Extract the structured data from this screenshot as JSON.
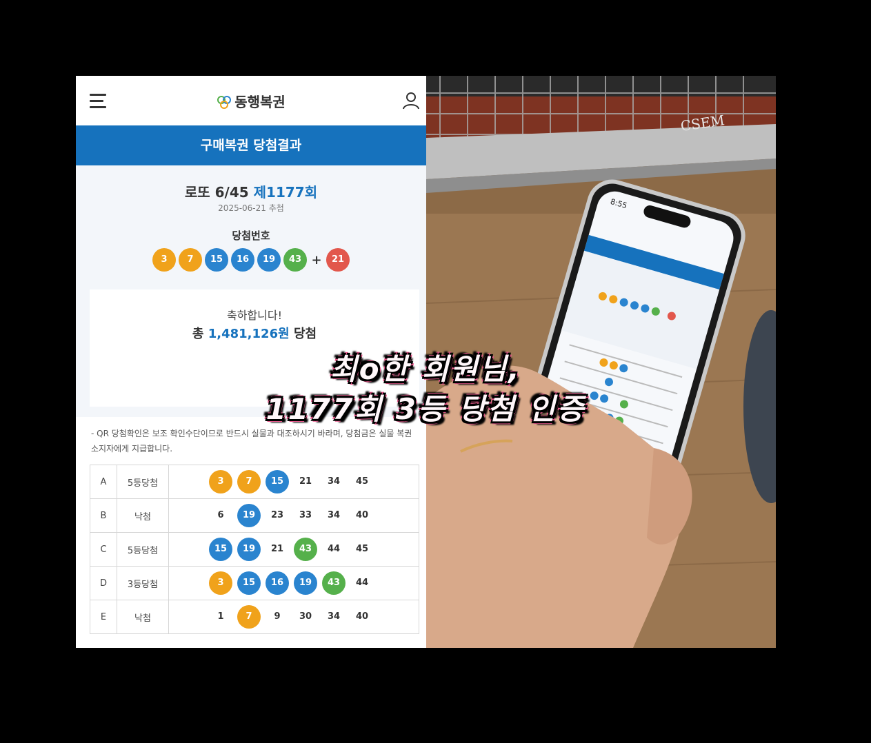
{
  "app": {
    "brand": "동행복권",
    "title": "구매복권 당첨결과",
    "game": "로또 6/45",
    "round": "제1177회",
    "draw_date": "2025-06-21 추첨",
    "winning_label": "당첨번호",
    "winning_numbers": [
      {
        "n": "3",
        "color": "#f0a21b"
      },
      {
        "n": "7",
        "color": "#f0a21b"
      },
      {
        "n": "15",
        "color": "#2a84cf"
      },
      {
        "n": "16",
        "color": "#2a84cf"
      },
      {
        "n": "19",
        "color": "#2a84cf"
      },
      {
        "n": "43",
        "color": "#55b04b"
      }
    ],
    "plus": "+",
    "bonus_number": {
      "n": "21",
      "color": "#e2574c"
    },
    "congrats": "축하합니다!",
    "total_prefix": "총",
    "total_amount": "1,481,126원",
    "total_suffix": "당첨",
    "notice": "- QR 당첨확인은 보조 확인수단이므로 반드시 실물과 대조하시기 바라며, 당첨금은 실물 복권소지자에게 지급합니다.",
    "results": [
      {
        "letter": "A",
        "rank": "5등당첨",
        "nums": [
          {
            "n": "3",
            "c": "#f0a21b"
          },
          {
            "n": "7",
            "c": "#f0a21b"
          },
          {
            "n": "15",
            "c": "#2a84cf"
          },
          {
            "n": "21"
          },
          {
            "n": "34"
          },
          {
            "n": "45"
          }
        ]
      },
      {
        "letter": "B",
        "rank": "낙첨",
        "nums": [
          {
            "n": "6"
          },
          {
            "n": "19",
            "c": "#2a84cf"
          },
          {
            "n": "23"
          },
          {
            "n": "33"
          },
          {
            "n": "34"
          },
          {
            "n": "40"
          }
        ]
      },
      {
        "letter": "C",
        "rank": "5등당첨",
        "nums": [
          {
            "n": "15",
            "c": "#2a84cf"
          },
          {
            "n": "19",
            "c": "#2a84cf"
          },
          {
            "n": "21"
          },
          {
            "n": "43",
            "c": "#55b04b"
          },
          {
            "n": "44"
          },
          {
            "n": "45"
          }
        ]
      },
      {
        "letter": "D",
        "rank": "3등당첨",
        "nums": [
          {
            "n": "3",
            "c": "#f0a21b"
          },
          {
            "n": "15",
            "c": "#2a84cf"
          },
          {
            "n": "16",
            "c": "#2a84cf"
          },
          {
            "n": "19",
            "c": "#2a84cf"
          },
          {
            "n": "43",
            "c": "#55b04b"
          },
          {
            "n": "44"
          }
        ]
      },
      {
        "letter": "E",
        "rank": "낙첨",
        "nums": [
          {
            "n": "1"
          },
          {
            "n": "7",
            "c": "#f0a21b"
          },
          {
            "n": "9"
          },
          {
            "n": "30"
          },
          {
            "n": "34"
          },
          {
            "n": "40"
          }
        ]
      }
    ]
  },
  "caption": {
    "line1": "최o한 회원님,",
    "line2": "1177회 3등 당첨 인증"
  },
  "photo": {
    "phone_time": "8:55",
    "grill_text": "CSEM"
  }
}
